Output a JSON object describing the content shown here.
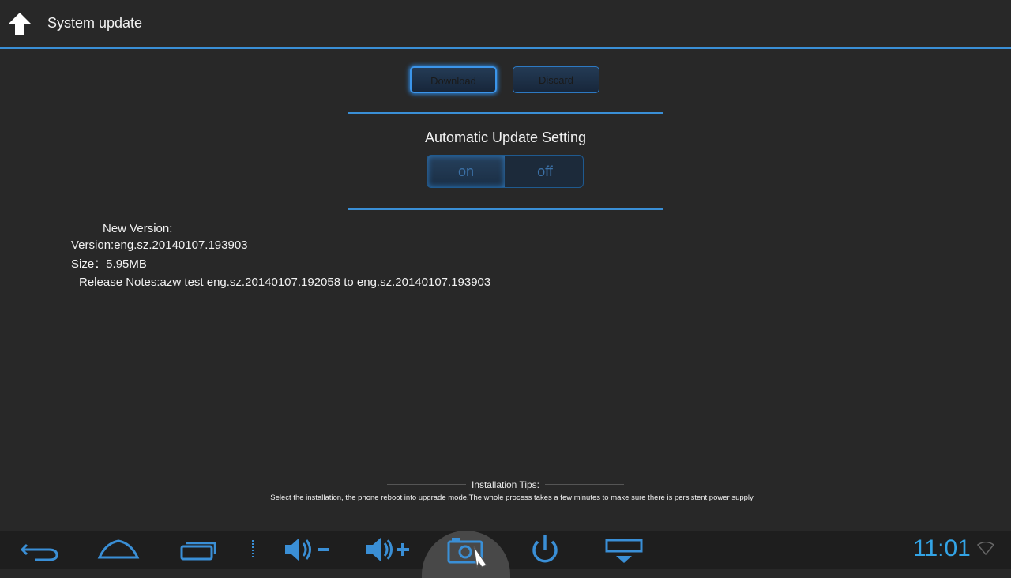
{
  "actionbar": {
    "title": "System update"
  },
  "buttons": {
    "download": "Download",
    "discard": "Discard"
  },
  "auto_update": {
    "title": "Automatic Update Setting",
    "on": "on",
    "off": "off",
    "selected": "on"
  },
  "version_info": {
    "new_version": "New Version:",
    "version": "Version:eng.sz.20140107.193903",
    "size": "Size：5.95MB",
    "release_notes": "Release Notes:azw test eng.sz.20140107.192058 to eng.sz.20140107.193903"
  },
  "tips": {
    "title": "Installation Tips:",
    "text": "Select the installation, the phone reboot into upgrade mode.The whole process takes a few minutes to make sure there is persistent power supply."
  },
  "navbar": {
    "icons": [
      "back-icon",
      "home-icon",
      "recent-apps-icon",
      "volume-down-icon",
      "volume-up-icon",
      "screenshot-icon",
      "power-icon",
      "hide-bar-icon"
    ],
    "clock": "11:01"
  },
  "colors": {
    "accent": "#3a8fd6",
    "clock": "#33a4e6",
    "background": "#282828"
  }
}
